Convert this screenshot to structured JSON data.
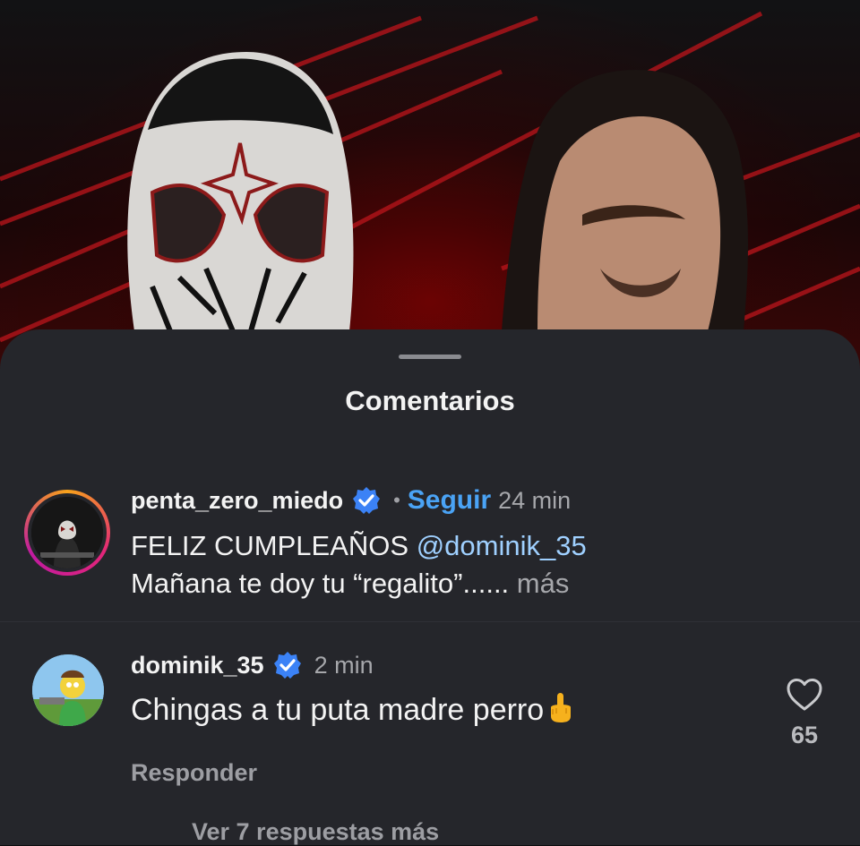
{
  "sheet": {
    "title": "Comentarios"
  },
  "comments": [
    {
      "username": "penta_zero_miedo",
      "verified": true,
      "separator": "•",
      "follow_label": "Seguir",
      "time": "24 min",
      "line1_prefix": "FELIZ CUMPLEAÑOS ",
      "mention": "@dominik_35",
      "line2": "Mañana te doy tu “regalito”......",
      "more_label": " más"
    },
    {
      "username": "dominik_35",
      "verified": true,
      "time": "2 min",
      "text": "Chingas a tu puta madre perro",
      "emoji": "middle-finger-emoji",
      "reply_label": "Responder",
      "like_count": "65",
      "view_replies_label": "Ver 7 respuestas más"
    }
  ],
  "colors": {
    "sheet_bg": "#25262b",
    "accent_blue": "#4aa3f5",
    "mention": "#9fd0ff",
    "verified_badge": "#3b82f6"
  },
  "icons": [
    "verified-badge-icon",
    "heart-outline-icon",
    "drag-handle"
  ]
}
